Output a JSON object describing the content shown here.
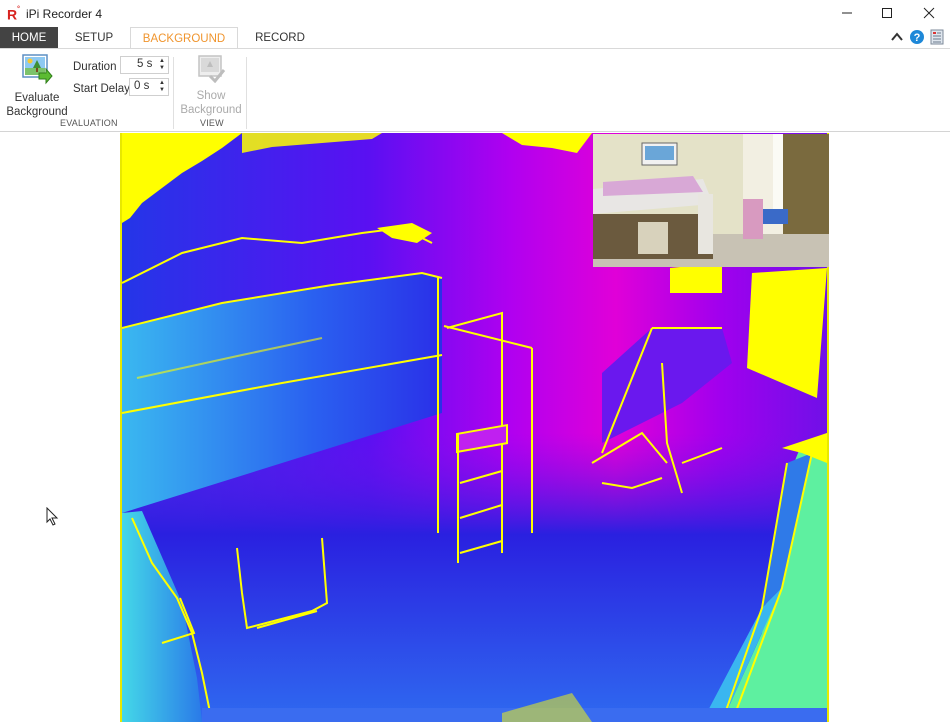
{
  "window": {
    "logo_text": "R",
    "logo_mark": "°",
    "title": "iPi Recorder 4",
    "controls": {
      "minimize": "—",
      "maximize": "☐",
      "close": "✕"
    }
  },
  "tabs": [
    {
      "label": "HOME",
      "active": false
    },
    {
      "label": "SETUP",
      "active": false
    },
    {
      "label": "BACKGROUND",
      "active": true
    },
    {
      "label": "RECORD",
      "active": false
    }
  ],
  "tab_icons": [
    "collapse-ribbon-icon",
    "help-icon",
    "log-icon"
  ],
  "ribbon": {
    "evaluation": {
      "group_label": "EVALUATION",
      "evaluate_button": {
        "line1": "Evaluate",
        "line2": "Background"
      },
      "duration": {
        "label": "Duration",
        "value": "5 s"
      },
      "start_delay": {
        "label": "Start Delay",
        "value": "0 s"
      }
    },
    "view": {
      "group_label": "VIEW",
      "show_button": {
        "line1": "Show",
        "line2": "Background",
        "enabled": false
      }
    }
  },
  "colors": {
    "accent_tab": "#f0952e",
    "home_tab_bg": "#434343",
    "depth_invalid": "#ffff00",
    "depth_near": "#5ef0a0",
    "depth_mid": "#2a3cf0",
    "depth_far": "#e000e0"
  }
}
